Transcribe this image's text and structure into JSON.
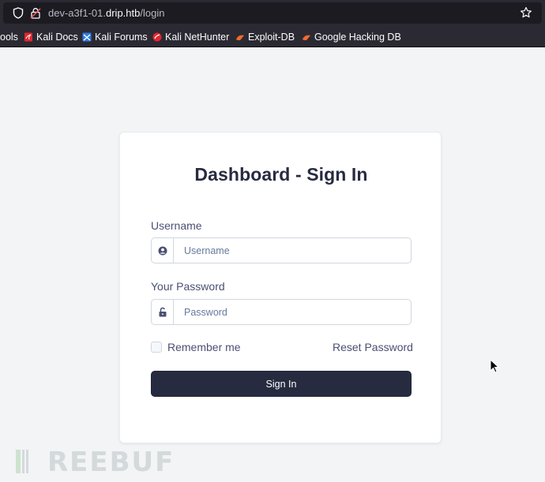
{
  "browser": {
    "url_prefix": "dev-a3f1-01.",
    "url_host": "drip.htb",
    "url_path": "/login",
    "bookmarks": [
      {
        "label": "ools",
        "icon": "tools-icon"
      },
      {
        "label": "Kali Docs",
        "icon": "kali-docs-icon"
      },
      {
        "label": "Kali Forums",
        "icon": "kali-forums-icon"
      },
      {
        "label": "Kali NetHunter",
        "icon": "kali-nethunter-icon"
      },
      {
        "label": "Exploit-DB",
        "icon": "exploit-db-icon"
      },
      {
        "label": "Google Hacking DB",
        "icon": "google-hacking-db-icon"
      }
    ]
  },
  "login": {
    "title": "Dashboard - Sign In",
    "username_label": "Username",
    "username_placeholder": "Username",
    "username_value": "",
    "password_label": "Your Password",
    "password_placeholder": "Password",
    "password_value": "",
    "remember_label": "Remember me",
    "remember_checked": false,
    "reset_label": "Reset Password",
    "signin_label": "Sign In"
  },
  "watermark": {
    "text": "REEBUF"
  },
  "colors": {
    "primary": "#262b40",
    "page_bg": "#f2f4f6",
    "chrome_bg": "#2b2a33",
    "label_text": "#4a5073"
  }
}
